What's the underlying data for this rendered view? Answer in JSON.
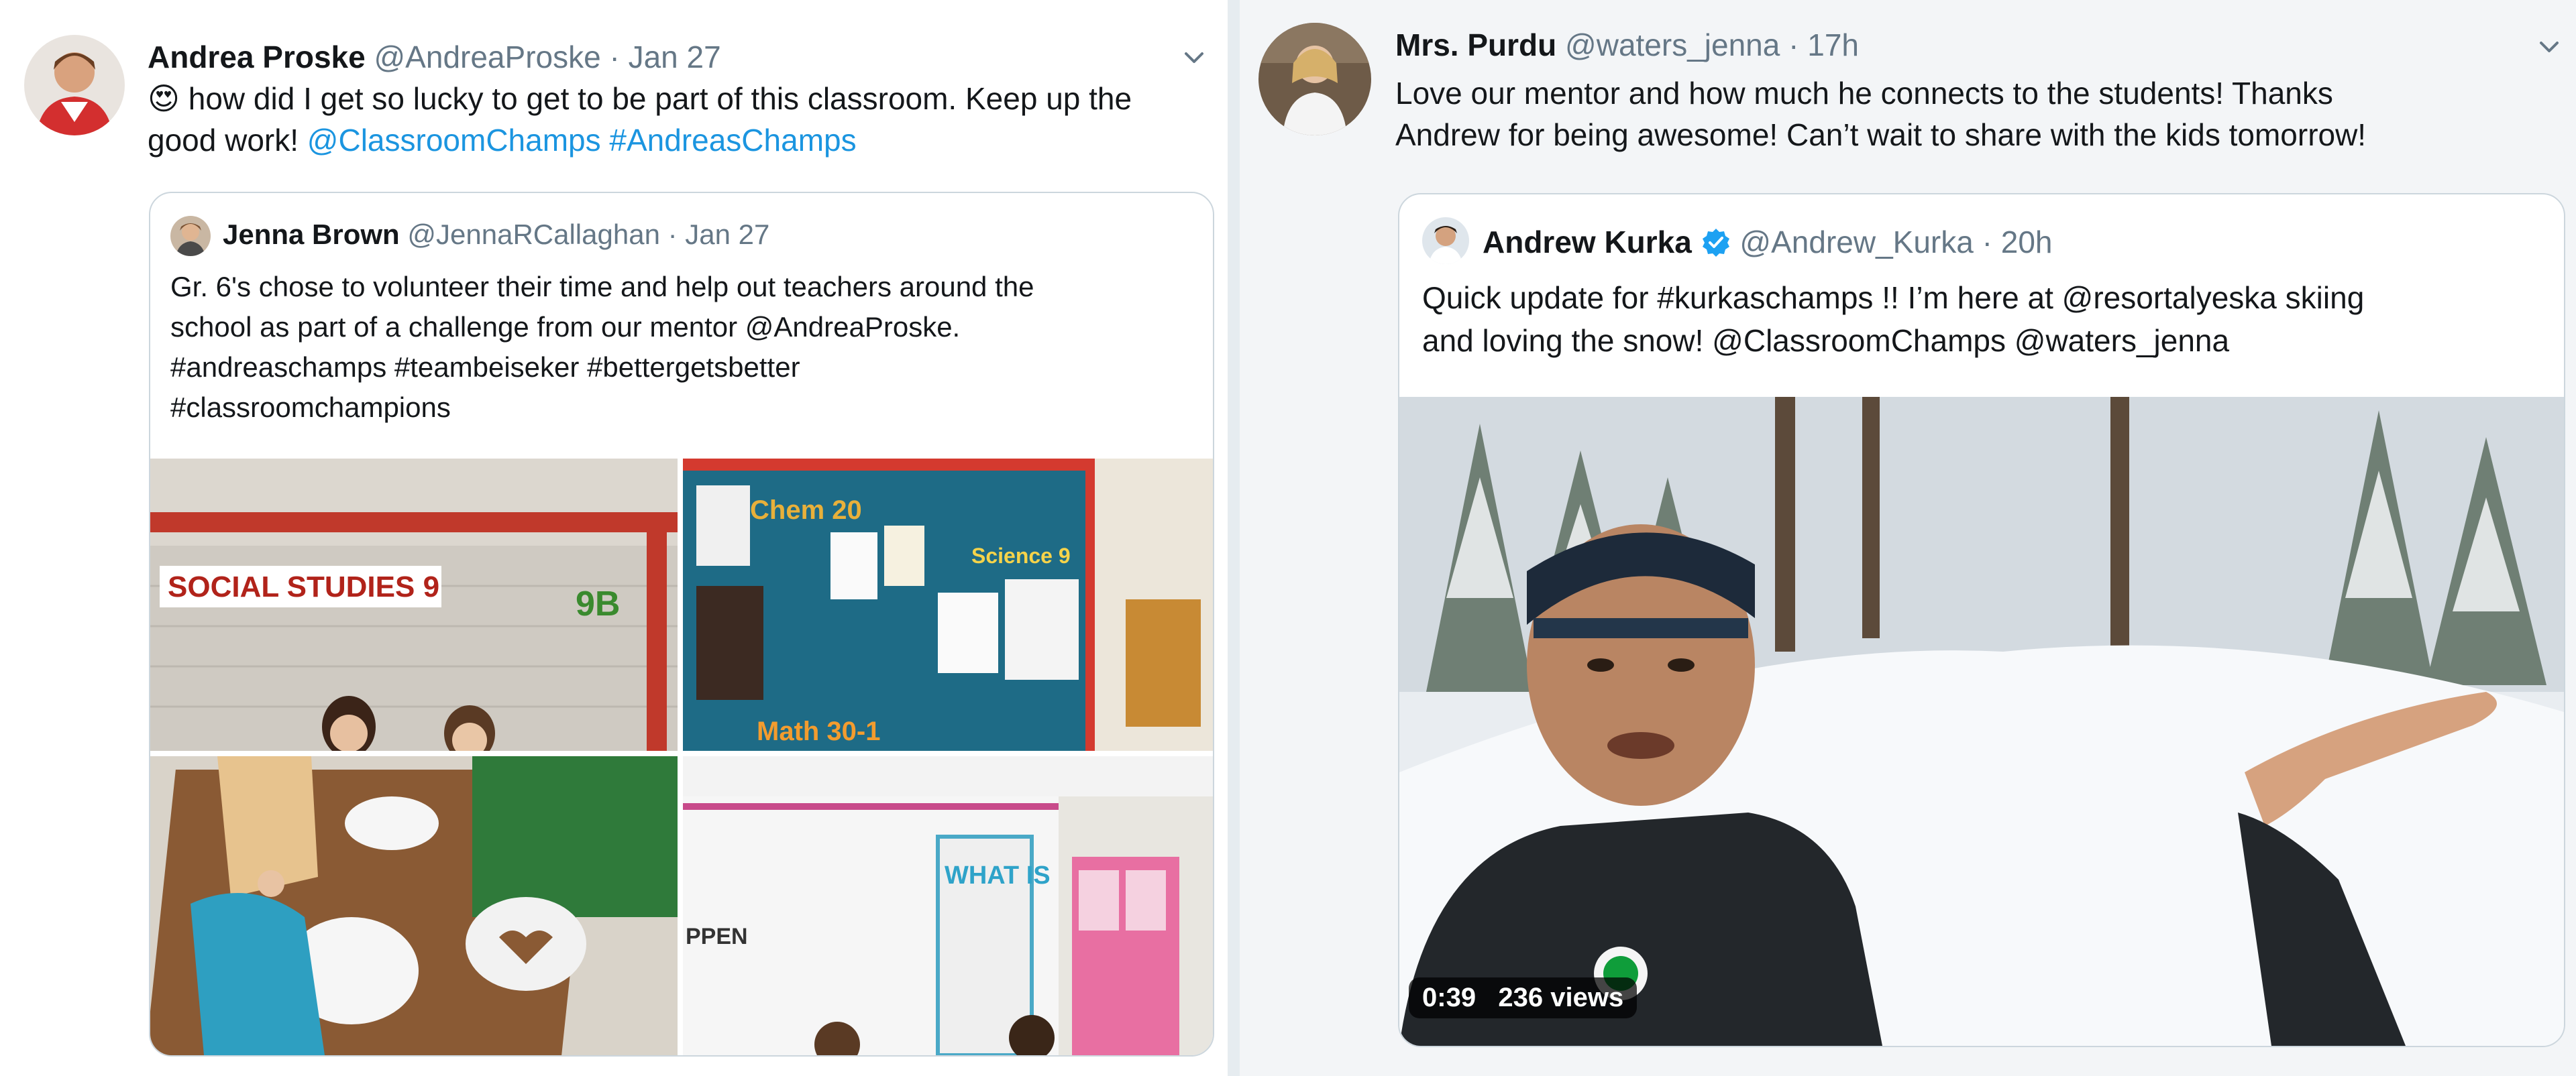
{
  "left_tweet": {
    "author_name": "Andrea Proske",
    "handle": "@AndreaProske",
    "time": "Jan 27",
    "separator": "·",
    "emoji": "😍",
    "text_line1": "how did I get so lucky to get to be part of this classroom. Keep up the",
    "text_line2_plain": "good work!",
    "text_line2_links": [
      "@ClassroomChamps",
      "#AndreasChamps"
    ],
    "quote": {
      "author_name": "Jenna Brown",
      "handle": "@JennaRCallaghan",
      "time": "Jan 27",
      "separator": "·",
      "lines": [
        "Gr. 6's chose to volunteer their time and help out teachers around the",
        "school as part of a challenge from our mentor @AndreaProske.",
        "#andreaschamps #teambeiseker #bettergetsbetter",
        "#classroomchampions"
      ],
      "photo_texts": {
        "social_studies": "SOCIAL STUDIES 9",
        "room": "9B",
        "chem": "Chem 20",
        "science": "Science 9",
        "math": "Math 30-1",
        "what": "WHAT IS",
        "ppen": "PPEN"
      }
    }
  },
  "right_tweet": {
    "author_name": "Mrs. Purdu",
    "handle": "@waters_jenna",
    "time": "17h",
    "separator": "·",
    "text_line1": "Love our mentor and how much he connects to the students! Thanks",
    "text_line2": "Andrew for being awesome! Can’t wait to share with the kids tomorrow!",
    "quote": {
      "author_name": "Andrew Kurka",
      "verified": true,
      "handle": "@Andrew_Kurka",
      "time": "20h",
      "separator": "·",
      "lines": [
        "Quick update for #kurkaschamps !! I’m here at @resortalyeska skiing",
        "and loving the snow! @ClassroomChamps @waters_jenna"
      ],
      "video": {
        "duration": "0:39",
        "views": "236 views"
      }
    }
  },
  "colors": {
    "link": "#1b95e0",
    "secondary_text": "#657786",
    "border": "#ccd6dd",
    "verified": "#1da1f2"
  }
}
